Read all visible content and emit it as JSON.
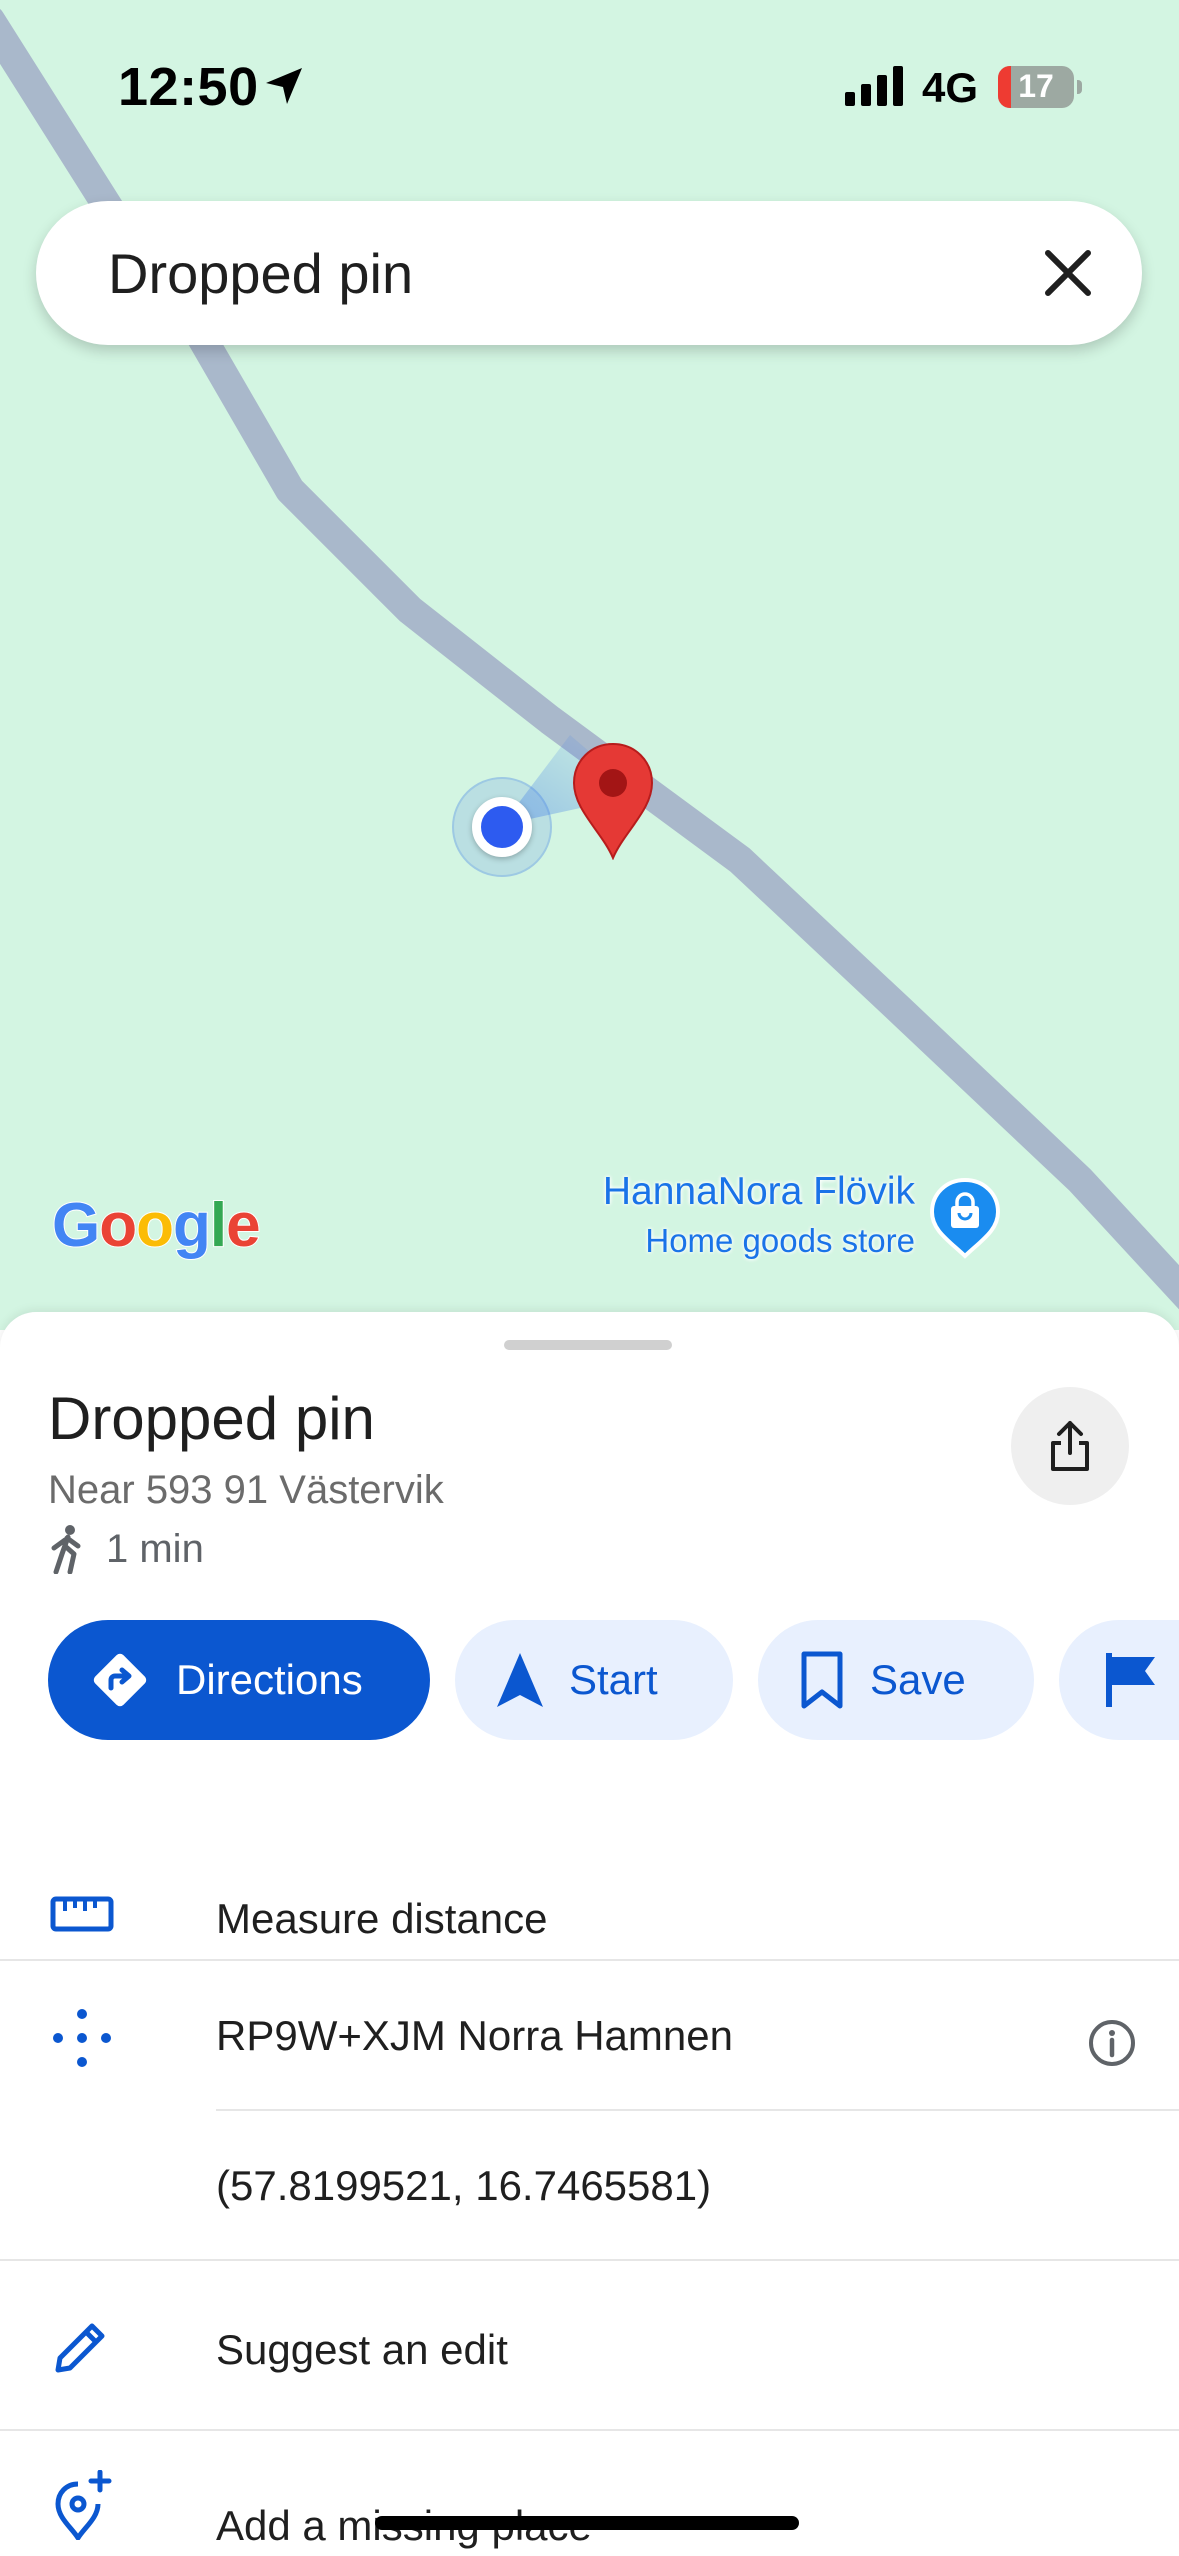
{
  "status_bar": {
    "time": "12:50",
    "network": "4G",
    "battery": "17",
    "battery_level": 0.17
  },
  "search": {
    "query": "Dropped pin"
  },
  "map": {
    "logo": [
      "G",
      "o",
      "o",
      "g",
      "l",
      "e"
    ],
    "poi": {
      "name": "HannaNora Flövik",
      "type": "Home goods store"
    }
  },
  "place": {
    "title": "Dropped pin",
    "address": "Near 593 91 Västervik",
    "walk_time": "1 min"
  },
  "actions": {
    "directions": "Directions",
    "start": "Start",
    "save": "Save"
  },
  "details": {
    "measure": "Measure distance",
    "plus_code": "RP9W+XJM Norra Hamnen",
    "coordinates": "(57.8199521, 16.7465581)",
    "suggest_edit": "Suggest an edit",
    "add_place": "Add a missing place"
  },
  "colors": {
    "accent": "#0b57d0",
    "map_bg": "#d3f5e2",
    "road": "#a9b8cb",
    "pin": "#e53935"
  }
}
